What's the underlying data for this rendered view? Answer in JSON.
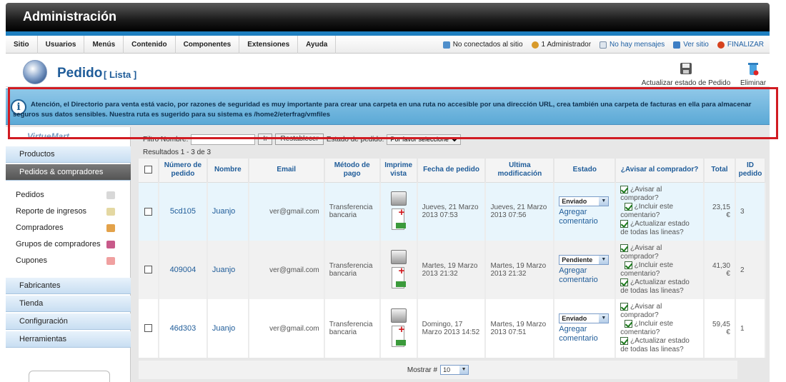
{
  "header": {
    "title": "Administración"
  },
  "menu": [
    "Sitio",
    "Usuarios",
    "Menús",
    "Contenido",
    "Componentes",
    "Extensiones",
    "Ayuda"
  ],
  "status": {
    "offline": "No conectados al sitio",
    "admins": "1 Administrador",
    "messages": "No hay mensajes",
    "view_site": "Ver sitio",
    "logout": "FINALIZAR"
  },
  "page": {
    "title": "Pedido",
    "subtitle": "[ Lista ]"
  },
  "toolbar": {
    "update": "Actualizar estado de Pedido",
    "delete": "Eliminar"
  },
  "warning": "Atención, el Directorio para venta está vacio, por razones de seguridad es muy importante para crear una carpeta en una ruta no accesible por una dirección URL, crea también una carpeta de facturas en ella para almacenar seguros sus datos sensibles. Nuestra ruta es sugerido para su sistema es /home2/eterfrag/vmfiles",
  "sidebar": {
    "logo": "VirtueMart",
    "sections": [
      "Productos",
      "Pedidos & compradores",
      "Fabricantes",
      "Tienda",
      "Configuración",
      "Herramientas"
    ],
    "sub_items": [
      "Pedidos",
      "Reporte de ingresos",
      "Compradores",
      "Grupos de compradores",
      "Cupones"
    ]
  },
  "filter": {
    "label": "Filtro Nombre:",
    "go": "Ir",
    "reset": "Restablecer",
    "state_label": "Estado de pedido:",
    "state_value": "Por favor seleccione"
  },
  "results": "Resultados 1 - 3 de 3",
  "columns": [
    "Número de pedido",
    "Nombre",
    "Email",
    "Método de pago",
    "Imprime vista",
    "Fecha de pedido",
    "Ultima modificación",
    "Estado",
    "¿Avisar al comprador?",
    "Total",
    "ID pedido"
  ],
  "orders": [
    {
      "number": "5cd105",
      "name": "Juanjo",
      "email": "ver@gmail.com",
      "payment": "Transferencia bancaria",
      "created": "Jueves, 21 Marzo 2013 07:53",
      "modified": "Jueves, 21 Marzo 2013 07:56",
      "status": "Enviado",
      "total": "23,15 €",
      "id": "3"
    },
    {
      "number": "409004",
      "name": "Juanjo",
      "email": "ver@gmail.com",
      "payment": "Transferencia bancaria",
      "created": "Martes, 19 Marzo 2013 21:32",
      "modified": "Martes, 19 Marzo 2013 21:32",
      "status": "Pendiente",
      "total": "41,30 €",
      "id": "2"
    },
    {
      "number": "46d303",
      "name": "Juanjo",
      "email": "ver@gmail.com",
      "payment": "Transferencia bancaria",
      "created": "Domingo, 17 Marzo 2013 14:52",
      "modified": "Martes, 19 Marzo 2013 07:51",
      "status": "Enviado",
      "total": "59,45 €",
      "id": "1"
    }
  ],
  "row_labels": {
    "add_comment": "Agregar comentario",
    "notify": "¿Avisar al comprador?",
    "include_comment": "¿Incluir este comentario?",
    "update_lines": "¿Actualizar estado de todas las lineas?"
  },
  "pager": {
    "label": "Mostrar #",
    "value": "10"
  },
  "colors": {
    "accent": "#1f5c99",
    "warning_bg": "#5ba9d6",
    "highlight": "#d11b22"
  }
}
